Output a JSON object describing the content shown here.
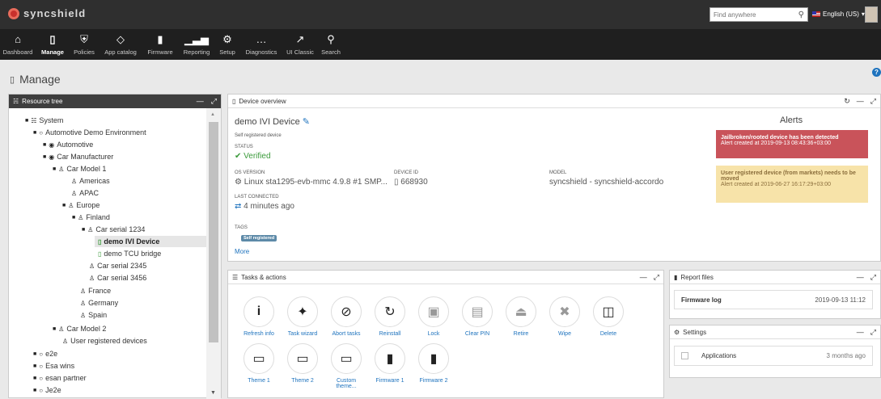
{
  "app": {
    "brand": "syncshield",
    "search_placeholder": "Find anywhere",
    "language": "English (US)"
  },
  "nav": [
    {
      "label": "Dashboard",
      "icon": "home-icon"
    },
    {
      "label": "Manage",
      "icon": "mobile-icon",
      "active": true
    },
    {
      "label": "Policies",
      "icon": "shield-icon"
    },
    {
      "label": "App catalog",
      "icon": "diamond-icon"
    },
    {
      "label": "Firmware",
      "icon": "chip-icon"
    },
    {
      "label": "Reporting",
      "icon": "bar-chart-icon"
    },
    {
      "label": "Setup",
      "icon": "gear-icon"
    },
    {
      "label": "Diagnostics",
      "icon": "paw-icon"
    },
    {
      "label": "UI Classic",
      "icon": "external-link-icon"
    },
    {
      "label": "Search",
      "icon": "search-icon"
    }
  ],
  "page": {
    "title": "Manage"
  },
  "resource_tree": {
    "title": "Resource tree",
    "nodes": [
      {
        "label": "System"
      },
      {
        "label": "Automotive Demo Environment"
      },
      {
        "label": "Automotive"
      },
      {
        "label": "Car Manufacturer"
      },
      {
        "label": "Car Model 1"
      },
      {
        "label": "Americas"
      },
      {
        "label": "APAC"
      },
      {
        "label": "Europe"
      },
      {
        "label": "Finland"
      },
      {
        "label": "Car serial 1234"
      },
      {
        "label": "demo IVI Device",
        "selected": true
      },
      {
        "label": "demo TCU bridge"
      },
      {
        "label": "Car serial 2345"
      },
      {
        "label": "Car serial 3456"
      },
      {
        "label": "France"
      },
      {
        "label": "Germany"
      },
      {
        "label": "Spain"
      },
      {
        "label": "Car Model 2"
      },
      {
        "label": "User registered devices"
      },
      {
        "label": "e2e"
      },
      {
        "label": "Esa wins"
      },
      {
        "label": "esan partner"
      },
      {
        "label": "Je2e"
      }
    ]
  },
  "device_overview": {
    "title": "Device overview",
    "name": "demo IVI Device",
    "subtitle": "Self registered device",
    "status_label": "STATUS",
    "status": "Verified",
    "os_label": "OS VERSION",
    "os": "Linux sta1295-evb-mmc 4.9.8 #1 SMP...",
    "device_id_label": "DEVICE ID",
    "device_id": "668930",
    "model_label": "MODEL",
    "model": "syncshield - syncshield-accordo",
    "last_connected_label": "LAST CONNECTED",
    "last_connected": "4 minutes ago",
    "tags_label": "TAGS",
    "tag": "Self registered",
    "more": "More",
    "alerts_title": "Alerts",
    "alerts": [
      {
        "title": "Jailbroken/rooted device has been detected",
        "time": "Alert created at 2019-09-13 08:43:36+03:00"
      },
      {
        "title": "User registered device (from markets) needs to be moved",
        "time": "Alert created at 2019-06-27 16:17:29+03:00"
      }
    ]
  },
  "tasks": {
    "title": "Tasks & actions",
    "row1": [
      {
        "label": "Refresh info",
        "icon": "info-icon"
      },
      {
        "label": "Task wizard",
        "icon": "magic-wand-icon"
      },
      {
        "label": "Abort tasks",
        "icon": "ban-icon"
      },
      {
        "label": "Reinstall",
        "icon": "refresh-icon"
      },
      {
        "label": "Lock",
        "icon": "lock-icon"
      },
      {
        "label": "Clear PIN",
        "icon": "unlock-icon"
      },
      {
        "label": "Retire",
        "icon": "eject-icon"
      },
      {
        "label": "Wipe",
        "icon": "x-icon"
      },
      {
        "label": "Delete",
        "icon": "trash-icon"
      }
    ],
    "row2": [
      {
        "label": "Theme 1",
        "icon": "monitor-icon"
      },
      {
        "label": "Theme 2",
        "icon": "monitor-icon"
      },
      {
        "label": "Custom theme...",
        "icon": "monitor-icon"
      },
      {
        "label": "Firmware 1",
        "icon": "chip-icon"
      },
      {
        "label": "Firmware 2",
        "icon": "chip-icon"
      }
    ]
  },
  "report_files": {
    "title": "Report files",
    "name": "Firmware log",
    "date": "2019-09-13 11:12"
  },
  "settings": {
    "title": "Settings",
    "name": "Applications",
    "date": "3 months ago"
  },
  "colors": {
    "accent": "#1e73be",
    "alert_red": "#c9535a",
    "alert_yellow": "#f7e3a9",
    "verified": "#3a9a3a"
  }
}
